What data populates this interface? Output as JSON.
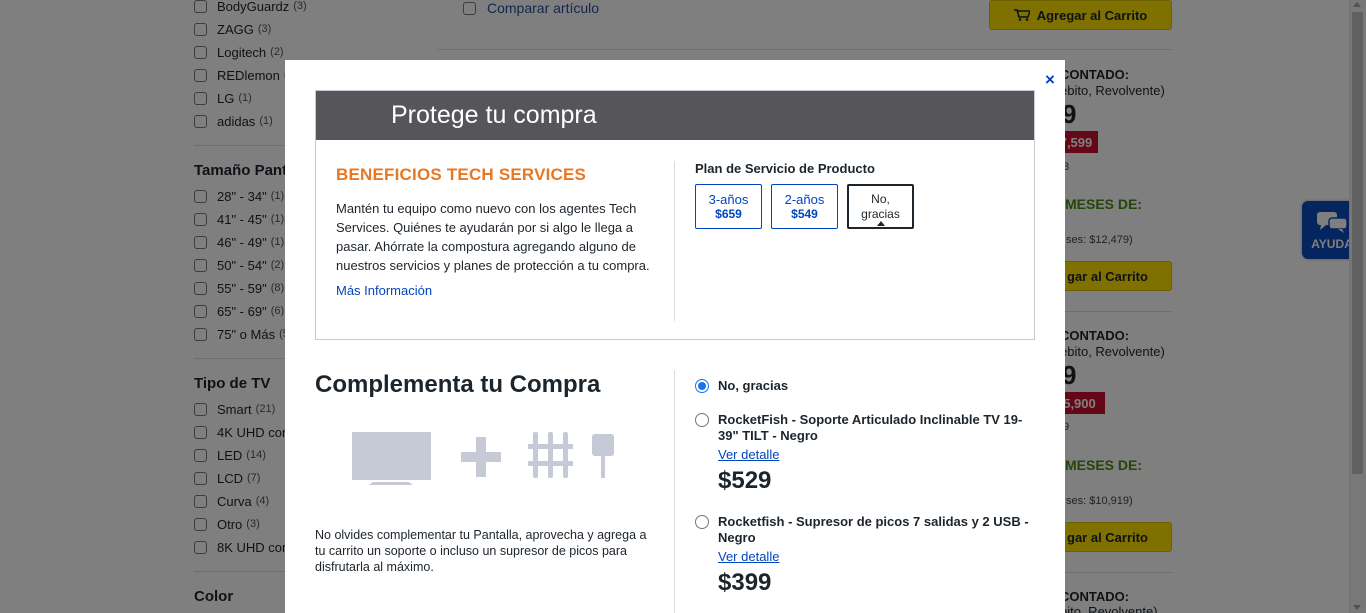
{
  "filters": {
    "brand_items": [
      {
        "label": "BodyGuardz",
        "count": "(3)"
      },
      {
        "label": "ZAGG",
        "count": "(3)"
      },
      {
        "label": "Logitech",
        "count": "(2)"
      },
      {
        "label": "REDlemon",
        "count": "("
      },
      {
        "label": "LG",
        "count": "(1)"
      },
      {
        "label": "adidas",
        "count": "(1)"
      }
    ],
    "size_heading": "Tamaño Pant",
    "size_items": [
      {
        "label": "28\" - 34\"",
        "count": "(1)"
      },
      {
        "label": "41\" - 45\"",
        "count": "(1)"
      },
      {
        "label": "46\" - 49\"",
        "count": "(1)"
      },
      {
        "label": "50\" - 54\"",
        "count": "(2)"
      },
      {
        "label": "55\" - 59\"",
        "count": "(8)"
      },
      {
        "label": "65\" - 69\"",
        "count": "(6)"
      },
      {
        "label": "75\" o Más",
        "count": "(5"
      }
    ],
    "type_heading": "Tipo de TV",
    "type_items": [
      {
        "label": "Smart",
        "count": "(21)"
      },
      {
        "label": "4K UHD con",
        "count": ""
      },
      {
        "label": "LED",
        "count": "(14)"
      },
      {
        "label": "LCD",
        "count": "(7)"
      },
      {
        "label": "Curva",
        "count": "(4)"
      },
      {
        "label": "Otro",
        "count": "(3)"
      },
      {
        "label": "8K UHD con",
        "count": ""
      }
    ],
    "color_heading": "Color"
  },
  "background": {
    "compare_label": "Comparar artículo",
    "add_to_cart": "Agregar al Carrito",
    "add_to_cart_partial": "gar al Carrito",
    "cash_label": "CONTADO:",
    "payment_note": "ébito, Revolvente)",
    "payment_note_b": "bito, Revolvente)",
    "price_partial_1": "9",
    "price_partial_2": "9",
    "tag_1": "7,599",
    "tag_2": "5,900",
    "line_8": "8",
    "line_9": "9",
    "months_label": "MESES DE:",
    "months_note_1": "ses: $12,479)",
    "months_note_2": "ses: $10,919)",
    "help_label": "AYUDA"
  },
  "modal": {
    "close_label": "×",
    "protect_title": "Protege tu compra",
    "benefits_title": "BENEFICIOS TECH SERVICES",
    "benefits_text": "Mantén tu equipo como nuevo con los agentes Tech Services. Quiénes te ayudarán por si algo le llega a pasar. Ahórrate la compostura agregando alguno de nuestros servicios y planes de protección a tu compra.",
    "more_info": "Más Información",
    "plan_label": "Plan de Servicio de Producto",
    "plans": [
      {
        "years": "3-años",
        "price": "$659"
      },
      {
        "years": "2-años",
        "price": "$549"
      }
    ],
    "plan_none_l1": "No,",
    "plan_none_l2": "gracias",
    "complement_title": "Complementa tu Compra",
    "complement_text": "No olvides complementar tu Pantalla, aprovecha y agrega a tu carrito un soporte o incluso un supresor de picos para disfrutarla al máximo.",
    "none_option": "No, gracias",
    "products": [
      {
        "name": "RocketFish - Soporte Articulado Inclinable TV 19-39\" TILT - Negro",
        "link": "Ver detalle",
        "price": "$529"
      },
      {
        "name": "Rocketfish - Supresor de picos 7 salidas y 2 USB - Negro",
        "link": "Ver detalle",
        "price": "$399"
      }
    ]
  }
}
